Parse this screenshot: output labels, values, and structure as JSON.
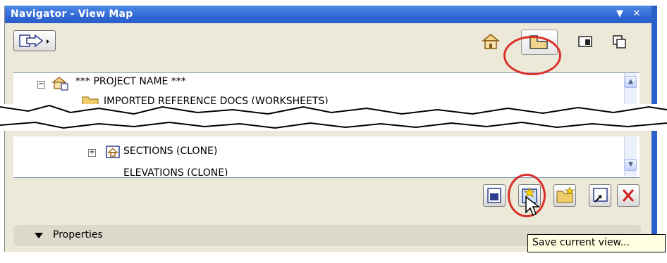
{
  "window": {
    "title": "Navigator - View Map"
  },
  "title_buttons": {
    "menu": "▼",
    "close": "✕"
  },
  "tree": {
    "items": [
      {
        "label": "*** PROJECT NAME ***",
        "expander": "−"
      },
      {
        "label": "IMPORTED REFERENCE DOCS (WORKSHEETS)",
        "expander": "+"
      },
      {
        "label": "SECTIONS (CLONE)",
        "expander": "+"
      },
      {
        "label": "ELEVATIONS (CLONE)",
        "expander": "+"
      }
    ]
  },
  "properties": {
    "label": "Properties"
  },
  "tooltip": {
    "text": "Save current view..."
  },
  "colors": {
    "titlebar": "#3168d5",
    "annotation": "#d9302a",
    "delete": "#d42020"
  }
}
